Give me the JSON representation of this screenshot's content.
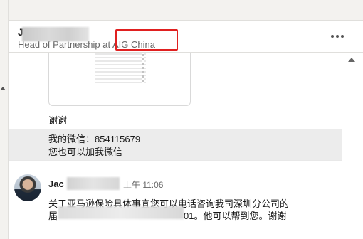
{
  "header": {
    "contact_name": "Jac",
    "contact_headline": "Head of Partnership at AIG China",
    "more_icon": "more-horizontal-icon"
  },
  "messages": {
    "thanks": "谢谢",
    "wechat_line1": "我的微信：854115679",
    "wechat_line2": "您也可以加我微信",
    "sender_name": "Jac",
    "time": "上午 11:06",
    "body_line1": "关于亚马逊保险具体事宜您可以电话咨询我司深圳分公司的",
    "body_line2_start": "届",
    "body_line2_end": "01。他可以帮到您。谢谢"
  },
  "colors": {
    "highlight": "#e02020",
    "page_bg": "#f3f2ef",
    "panel_bg": "#ffffff",
    "selected_bg": "#ececec"
  }
}
